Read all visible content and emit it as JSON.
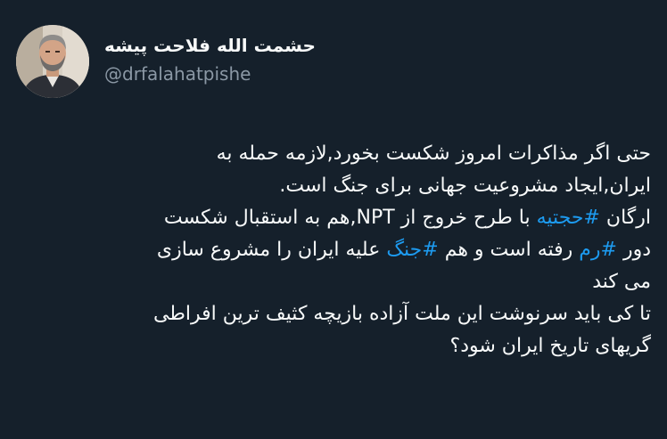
{
  "author": {
    "display_name": "حشمت الله فلاحت پیشه",
    "handle": "@drfalahatpishe"
  },
  "tweet": {
    "line1": "حتی اگر مذاکرات امروز شکست بخورد,لازمه حمله به",
    "line2": "ایران,ایجاد مشروعیت جهانی برای جنگ است.",
    "line3_a": "ارگان ",
    "hashtag_hojatieh": "#حجتیه",
    "line3_b": " با طرح خروج از NPT,هم به استقبال شکست",
    "line4_a": "دور ",
    "hashtag_ram": "#رم",
    "line4_b": " رفته است و هم ",
    "hashtag_jang": "#جنگ",
    "line4_c": " علیه ایران را مشروع سازی",
    "line5": "می کند",
    "line6": "تا کی باید سرنوشت این ملت آزاده بازیچه کثیف ترین افراطی",
    "line7": "گریهای تاریخ ایران شود؟"
  },
  "colors": {
    "background": "#15202b",
    "text": "#f7f9f9",
    "secondary_text": "#8b98a5",
    "hashtag": "#1d9bf0"
  }
}
